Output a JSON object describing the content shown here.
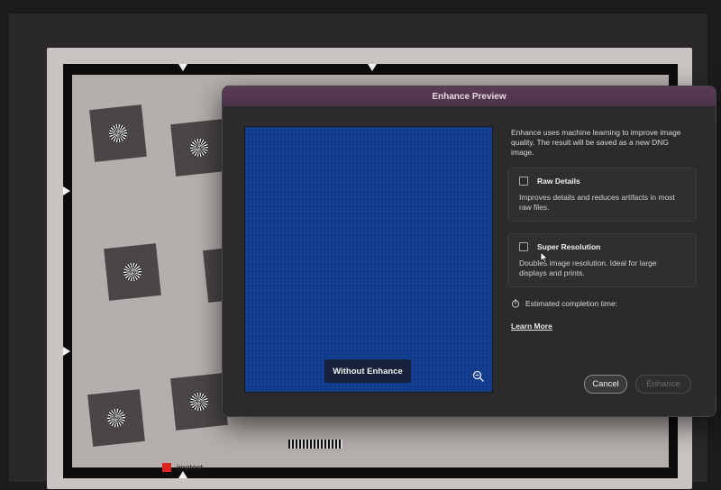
{
  "background": {
    "logo_text": "imatest"
  },
  "dialog": {
    "title": "Enhance Preview",
    "description": "Enhance uses machine learning to improve image quality. The result will be saved as a new DNG image.",
    "preview": {
      "toggle_label": "Without Enhance",
      "zoom_icon": "zoom-out-icon",
      "color": "#0f3b8c"
    },
    "options": [
      {
        "title": "Raw Details",
        "checked": false,
        "description": "Improves details and reduces artifacts in most raw files."
      },
      {
        "title": "Super Resolution",
        "checked": false,
        "description": "Doubles image resolution. Ideal for large displays and prints."
      }
    ],
    "estimate_label": "Estimated completion time:",
    "learn_more": "Learn More",
    "cancel_label": "Cancel",
    "enhance_label": "Enhance",
    "enhance_disabled": true
  },
  "colors": {
    "titlebar": "#52364e",
    "dialog_bg": "#2b2b2d",
    "preview_blue": "#0f3b8c"
  }
}
